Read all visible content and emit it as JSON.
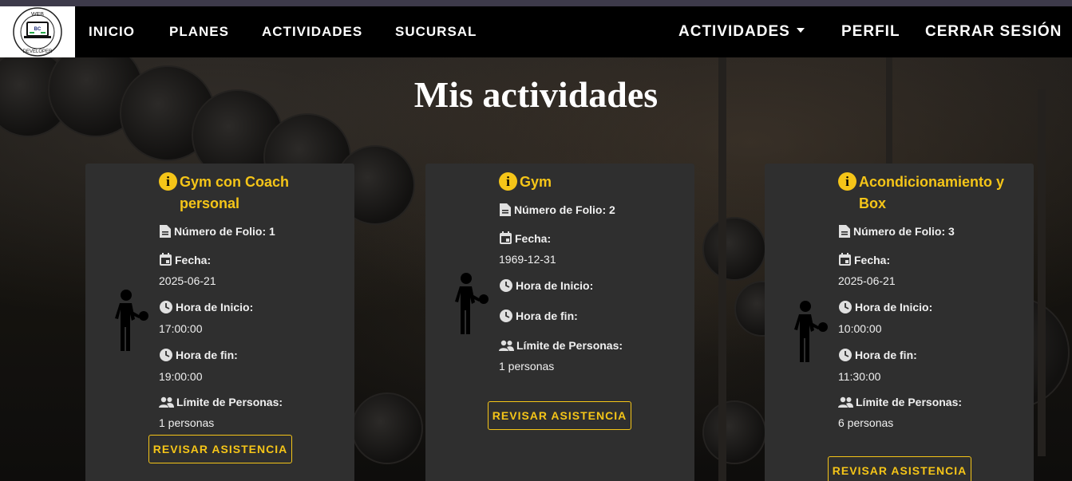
{
  "nav": {
    "logo_alt": "WEB DEVELOPER",
    "logo_text_top": "WEB",
    "logo_text_bottom": "DEVELOPER",
    "logo_initials": "BC",
    "left_links": [
      "INICIO",
      "PLANES",
      "ACTIVIDADES",
      "SUCURSAL"
    ],
    "right_dropdown": "ACTIVIDADES",
    "right_links": [
      "PERFIL",
      "CERRAR SESIÓN"
    ]
  },
  "page": {
    "title": "Mis actividades"
  },
  "labels": {
    "folio": "Número de Folio:",
    "fecha": "Fecha:",
    "inicio": "Hora de Inicio:",
    "fin": "Hora de fin:",
    "limite": "Límite de Personas:",
    "button": "REVISAR ASISTENCIA"
  },
  "cards": [
    {
      "title": "Gym con Coach personal",
      "folio": "1",
      "fecha": "2025-06-21",
      "inicio": "17:00:00",
      "fin": "19:00:00",
      "limite": "1 personas"
    },
    {
      "title": "Gym",
      "folio": "2",
      "fecha": "1969-12-31",
      "inicio": "",
      "fin": "",
      "limite": "1 personas"
    },
    {
      "title": "Acondicionamiento y Box",
      "folio": "3",
      "fecha": "2025-06-21",
      "inicio": "10:00:00",
      "fin": "11:30:00",
      "limite": "6 personas"
    }
  ],
  "colors": {
    "accent": "#f5c518",
    "card_bg": "#2f2f2f",
    "navbar_bg": "#000000"
  }
}
